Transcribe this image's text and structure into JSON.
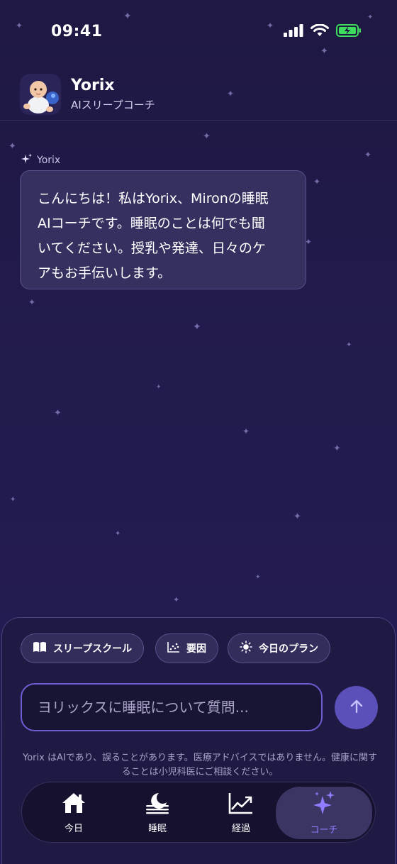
{
  "status_bar": {
    "time": "09:41"
  },
  "header": {
    "name": "Yorix",
    "subtitle": "AIスリープコーチ"
  },
  "chat": {
    "author": "Yorix",
    "message_lines": [
      "こんにちは！私はYorix、Mironの睡眠",
      "AIコーチです。睡眠のことは何でも聞",
      "いてください。授乳や発達、日々のケ",
      "アもお手伝いします。"
    ]
  },
  "chips": [
    {
      "label": "スリープスクール",
      "icon": "book-icon"
    },
    {
      "label": "要因",
      "icon": "scatter-chart-icon"
    },
    {
      "label": "今日のプラン",
      "icon": "sun-icon"
    }
  ],
  "input": {
    "placeholder": "ヨリックスに睡眠について質問..."
  },
  "disclaimer": "Yorix はAIであり、誤ることがあります。医療アドバイスではありません。健康に関することは小児科医にご相談ください。",
  "tabs": [
    {
      "label": "今日",
      "icon": "home-icon",
      "active": false
    },
    {
      "label": "睡眠",
      "icon": "moon-icon",
      "active": false
    },
    {
      "label": "経過",
      "icon": "trend-icon",
      "active": false
    },
    {
      "label": "コーチ",
      "icon": "sparkles-icon",
      "active": true
    }
  ],
  "colors": {
    "background": "#1e1842",
    "accent": "#8f7dff",
    "battery": "#3ddc5c"
  }
}
